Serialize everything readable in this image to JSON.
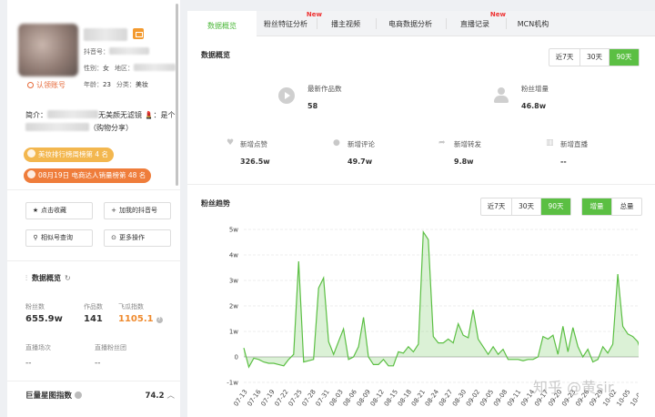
{
  "profile": {
    "douyin_id_label": "抖音号：",
    "gender_label": "性别：",
    "gender_value": "女",
    "region_label": "地区：",
    "age_label": "年龄：",
    "age_value": "23",
    "category_label": "分类：",
    "category_value": "美妆",
    "verify_label": "认领账号",
    "bio_prefix": "简介：",
    "bio_line1_tail": "无美颜无滤镜 💄：是个",
    "bio_line2_tail": "（购物分享）"
  },
  "tags": [
    {
      "label": "美妆排行榜周榜第 4 名",
      "color": "#f3b74f"
    },
    {
      "label": "08月19日  电商达人销量榜第 48 名",
      "color": "#ef7d3b"
    }
  ],
  "actions": {
    "favorite": "点击收藏",
    "add_douyin": "加我的抖音号",
    "similar": "相似号查询",
    "more": "更多操作"
  },
  "left_stats": {
    "title": "数据概览",
    "fans_label": "粉丝数",
    "fans_value": "655.9w",
    "works_label": "作品数",
    "works_value": "141",
    "feigua_label": "飞瓜指数",
    "feigua_value": "1105.1",
    "live_count_label": "直播场次",
    "live_count_value": "--",
    "live_fans_label": "直播粉丝团",
    "live_fans_value": "--",
    "star_label": "巨量星图指数",
    "star_value": "74.2",
    "accent": "#ef8a2e"
  },
  "tabs": [
    {
      "label": "数据概览",
      "new": ""
    },
    {
      "label": "粉丝特征分析",
      "new": "New"
    },
    {
      "label": "播主视频",
      "new": ""
    },
    {
      "label": "电商数据分析",
      "new": ""
    },
    {
      "label": "直播记录",
      "new": "New"
    },
    {
      "label": "MCN机构",
      "new": ""
    }
  ],
  "overview": {
    "title": "数据概览",
    "ranges": [
      "近7天",
      "30天",
      "90天"
    ],
    "selected_range": "90天",
    "latest_works_label": "最新作品数",
    "latest_works_value": "58",
    "fans_growth_label": "粉丝增量",
    "fans_growth_value": "46.8w",
    "likes_label": "新增点赞",
    "likes_value": "326.5w",
    "comments_label": "新增评论",
    "comments_value": "49.7w",
    "shares_label": "新增转发",
    "shares_value": "9.8w",
    "live_label": "新增直播",
    "live_value": "--"
  },
  "trend": {
    "title": "粉丝趋势",
    "ranges": [
      "近7天",
      "30天",
      "90天"
    ],
    "modes": [
      "增量",
      "总量"
    ],
    "accent": "#5bbf43"
  },
  "watermark": "知乎 @黄sir",
  "chart_data": {
    "type": "area",
    "title": "粉丝趋势",
    "ylim": [
      -1,
      5
    ],
    "yticks": [
      "-1w",
      "0",
      "1w",
      "2w",
      "3w",
      "4w",
      "5w"
    ],
    "ytick_values": [
      -1,
      0,
      1,
      2,
      3,
      4,
      5
    ],
    "xticks": [
      "07-13",
      "07-16",
      "07-19",
      "07-22",
      "07-25",
      "07-28",
      "07-31",
      "08-03",
      "08-06",
      "08-09",
      "08-12",
      "08-15",
      "08-18",
      "08-21",
      "08-24",
      "08-27",
      "08-30",
      "09-02",
      "09-05",
      "09-08",
      "09-11",
      "09-14",
      "09-17",
      "09-20",
      "09-23",
      "09-26",
      "09-29",
      "10-02",
      "10-05",
      "10-08"
    ],
    "series": [
      {
        "name": "",
        "color": "#5bbf43",
        "values": [
          0.35,
          -0.4,
          -0.05,
          -0.1,
          -0.2,
          -0.25,
          -0.25,
          -0.3,
          -0.35,
          -0.1,
          0.1,
          3.75,
          -0.2,
          -0.15,
          -0.1,
          2.7,
          3.1,
          0.6,
          0.1,
          0.6,
          1.1,
          -0.1,
          0.0,
          0.4,
          1.55,
          0.0,
          -0.3,
          -0.3,
          -0.1,
          -0.35,
          -0.35,
          0.2,
          0.15,
          0.4,
          0.2,
          0.5,
          4.9,
          4.6,
          0.8,
          0.55,
          0.55,
          0.7,
          0.55,
          1.3,
          0.85,
          0.75,
          1.85,
          0.7,
          0.4,
          0.1,
          0.4,
          0.1,
          0.3,
          -0.1,
          -0.1,
          -0.1,
          -0.15,
          -0.1,
          -0.1,
          0.0,
          0.8,
          0.7,
          0.85,
          0.1,
          1.2,
          0.2,
          1.15,
          0.4,
          0.0,
          0.3,
          -0.2,
          -0.1,
          0.4,
          0.15,
          0.5,
          3.25,
          1.2,
          0.9,
          0.8,
          0.6,
          0.0,
          0.0
        ]
      }
    ]
  }
}
